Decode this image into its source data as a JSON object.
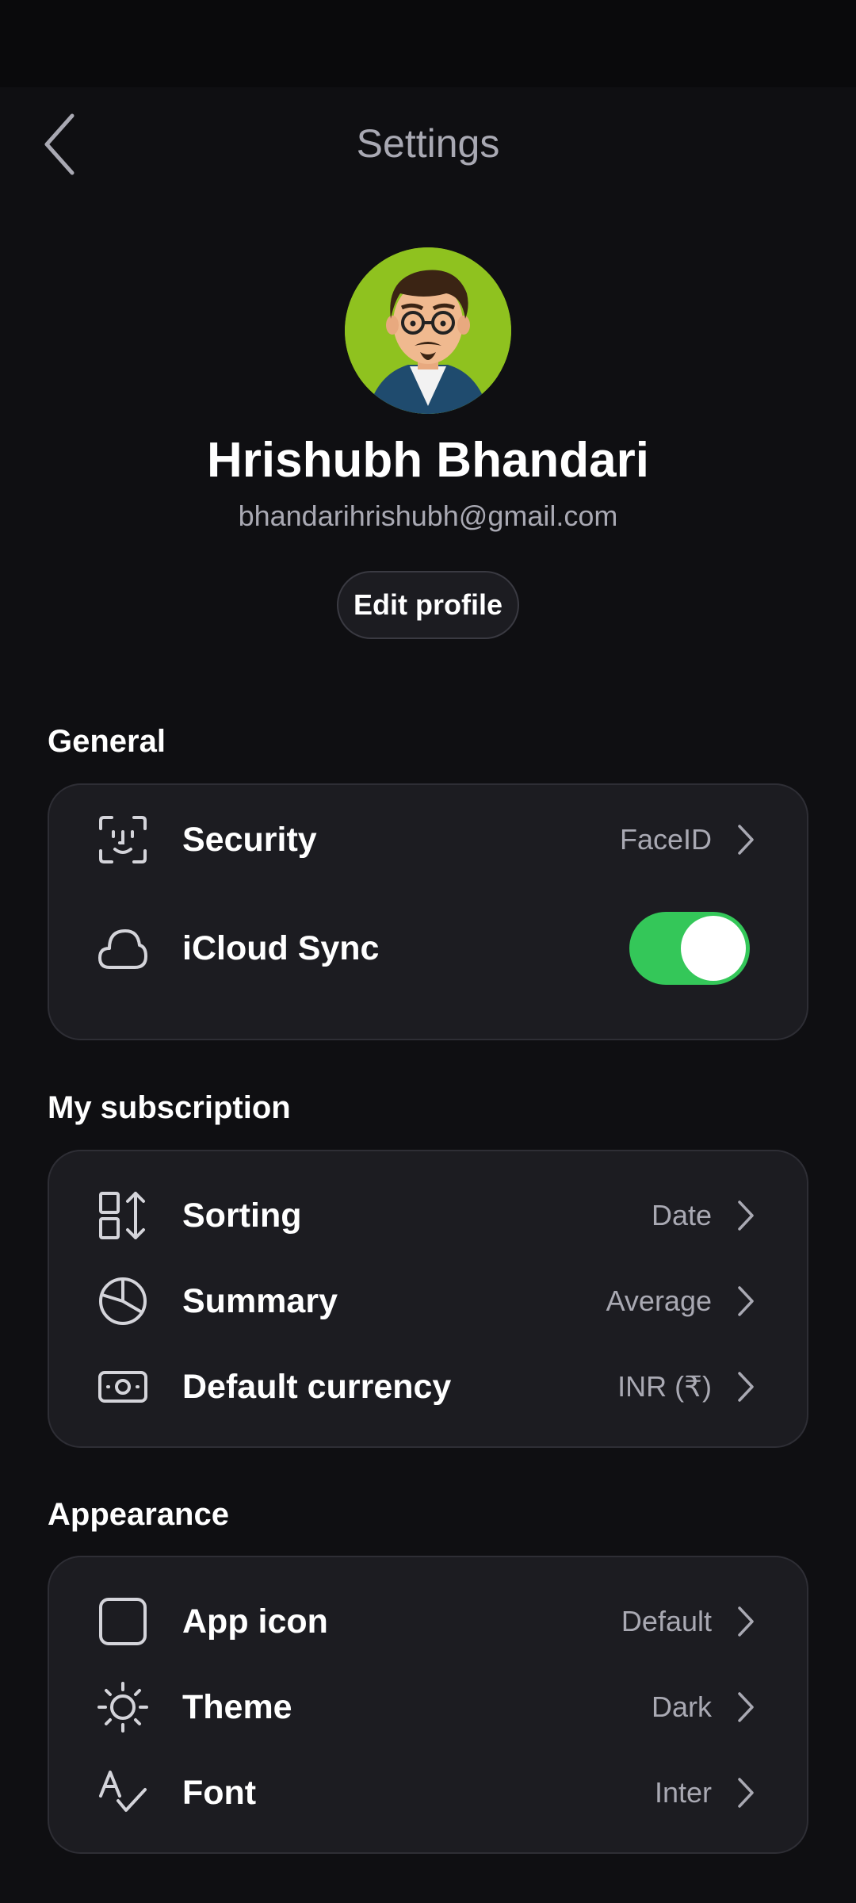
{
  "header": {
    "title": "Settings"
  },
  "profile": {
    "name": "Hrishubh Bhandari",
    "email": "bhandarihrishubh@gmail.com",
    "edit_label": "Edit profile"
  },
  "sections": {
    "general": {
      "title": "General",
      "security": {
        "label": "Security",
        "value": "FaceID",
        "icon": "face-id-icon"
      },
      "icloud": {
        "label": "iCloud Sync",
        "enabled": true,
        "icon": "cloud-icon"
      }
    },
    "subscription": {
      "title": "My subscription",
      "sorting": {
        "label": "Sorting",
        "value": "Date",
        "icon": "sort-icon"
      },
      "summary": {
        "label": "Summary",
        "value": "Average",
        "icon": "pie-chart-icon"
      },
      "currency": {
        "label": "Default currency",
        "value": "INR (₹)",
        "icon": "cash-icon"
      }
    },
    "appearance": {
      "title": "Appearance",
      "app_icon": {
        "label": "App icon",
        "value": "Default",
        "icon": "square-icon"
      },
      "theme": {
        "label": "Theme",
        "value": "Dark",
        "icon": "sun-icon"
      },
      "font": {
        "label": "Font",
        "value": "Inter",
        "icon": "font-check-icon"
      }
    }
  },
  "colors": {
    "background": "#0f0f12",
    "card": "#1c1c21",
    "accent": "#34c759",
    "muted": "#a9a9b3"
  }
}
